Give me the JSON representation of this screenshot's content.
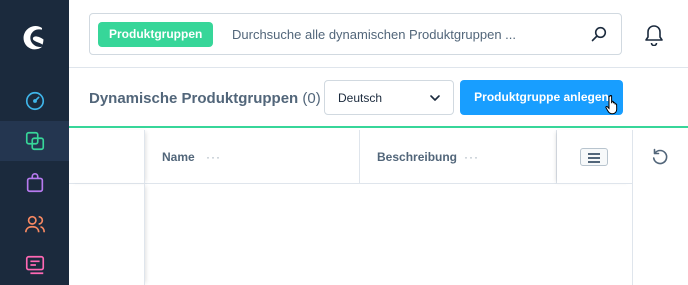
{
  "search": {
    "tag": "Produktgruppen",
    "placeholder": "Durchsuche alle dynamischen Produktgruppen ..."
  },
  "page": {
    "title": "Dynamische Produktgruppen",
    "count": "(0)"
  },
  "language_select": {
    "value": "Deutsch"
  },
  "actions": {
    "create_label": "Produktgruppe anlegen"
  },
  "grid": {
    "columns": [
      {
        "label": "Name",
        "menu": "···"
      },
      {
        "label": "Beschreibung",
        "menu": "···"
      }
    ]
  },
  "colors": {
    "sidebar": "#1b2a3d",
    "primary": "#189eff",
    "accent": "#37d699"
  }
}
